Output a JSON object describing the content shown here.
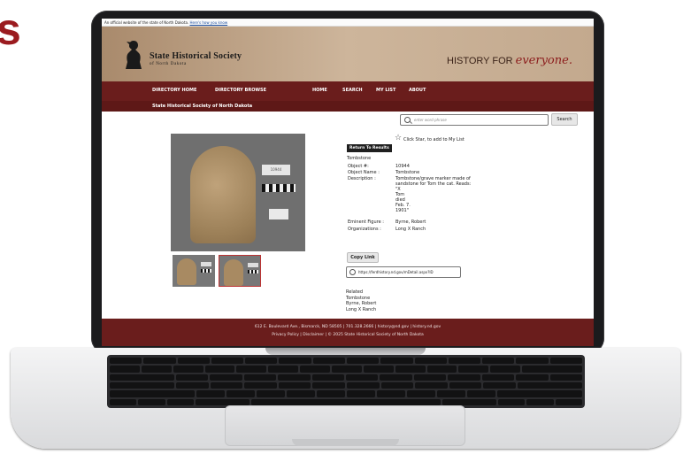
{
  "corner_text": "s",
  "site": {
    "official_notice": "An official website of the state of North Dakota.",
    "official_link": "Here's how you know",
    "org_title": "State Historical Society",
    "org_sub": "of North Dakota",
    "tagline_prefix": "HISTORY FOR",
    "tagline_script": "everyone."
  },
  "nav": {
    "directory_home": "DIRECTORY HOME",
    "directory_browse": "DIRECTORY BROWSE",
    "home": "HOME",
    "search": "SEARCH",
    "my_list": "MY LIST",
    "about": "ABOUT",
    "subnav": "State Historical Society of North Dakota"
  },
  "search": {
    "placeholder": "enter word phrase",
    "button": "Search"
  },
  "photo": {
    "tag_text": "10944"
  },
  "record": {
    "star_note": "Click Star, to add to My List",
    "return_button": "Return To Results",
    "crumb": "Tombstone",
    "fields": [
      {
        "label": "Object #:",
        "value": "10944"
      },
      {
        "label": "Object Name :",
        "value": "Tombstone"
      },
      {
        "label": "Description :",
        "value": "Tombstone/grave marker made of sandstone for Tom the cat. Reads: \"X Tom died Feb. 7. 1901\""
      },
      {
        "label": "Eminent Figure :",
        "value": "Byrne, Robert"
      },
      {
        "label": "Organizations :",
        "value": "Long X Ranch"
      }
    ],
    "description_lines": [
      "Tombstone/grave marker made of",
      "sandstone for Tom the cat. Reads:",
      "\"X",
      "Tom",
      "died",
      "Feb. 7.",
      "1901\""
    ],
    "copy_button": "Copy Link",
    "link_url": "https://ferdhistory.nd.gov/mDetail.aspx?ID",
    "related": [
      "Related",
      "Tombstone",
      "Byrne, Robert",
      "Long X Ranch"
    ]
  },
  "footer": {
    "address": "612 E. Boulevard Ave., Bismarck, ND 58505 | 701.328.2666 | history@nd.gov | history.nd.gov",
    "links": "Privacy Policy  |  Disclaimer  |  © 2025 State Historical Society of North Dakota"
  },
  "colors": {
    "nav": "#6a1d1c",
    "accent_red": "#9b1b1f",
    "header_tan": "#cdb59b"
  }
}
